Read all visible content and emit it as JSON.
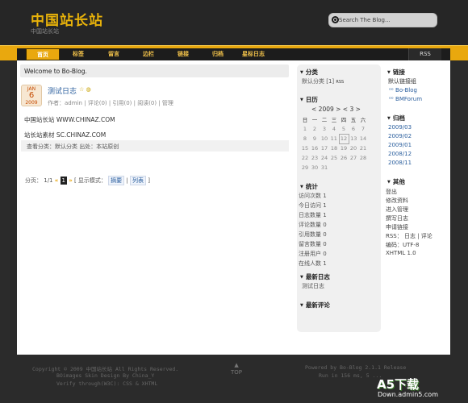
{
  "header": {
    "site_title": "中国站长站",
    "site_subtitle": "中国站长站",
    "search_placeholder": "Search The Blog..."
  },
  "nav": {
    "items": [
      "首页",
      "标签",
      "留言",
      "边栏",
      "链接",
      "归档",
      "星标日志"
    ],
    "rss_label": "RSS"
  },
  "welcome_text": "Welcome to Bo-Blog.",
  "post": {
    "date_month": "JAN",
    "date_day": "6",
    "date_year": "2009",
    "title": "测试日志",
    "icons": "☆ ◍",
    "meta": "作者：admin | 评论(0) | 引用(0) | 阅读(0) | 管理",
    "body_line1": "中国站长站 WWW.CHINAZ.COM",
    "body_line2": "站长站素材 SC.CHINAZ.COM",
    "footer": "查看分类：默认分类 出处：本站原创"
  },
  "pager": {
    "label": "分页：",
    "position": "1/1",
    "prev": "«",
    "current": "1",
    "next": "»",
    "mode_label": "[ 显示模式：",
    "mode_summary": "摘要",
    "separator": "|",
    "mode_list": "列表",
    "close": "]"
  },
  "sidebar1": {
    "category_title": "分类",
    "category_item": "默认分类 [1]",
    "category_rss": "RSS",
    "calendar_title": "日历",
    "calendar_header": "< 2009 >   < 3 >",
    "weekdays": [
      "日",
      "一",
      "二",
      "三",
      "四",
      "五",
      "六"
    ],
    "weeks": [
      [
        "1",
        "2",
        "3",
        "4",
        "5",
        "6",
        "7"
      ],
      [
        "8",
        "9",
        "10",
        "11",
        "12",
        "13",
        "14"
      ],
      [
        "15",
        "16",
        "17",
        "18",
        "19",
        "20",
        "21"
      ],
      [
        "22",
        "23",
        "24",
        "25",
        "26",
        "27",
        "28"
      ],
      [
        "29",
        "30",
        "31",
        "",
        "",
        "",
        ""
      ]
    ],
    "stats_title": "统计",
    "stats": [
      {
        "label": "访问次数",
        "value": "1"
      },
      {
        "label": "今日访问",
        "value": "1"
      },
      {
        "label": "日志数量",
        "value": "1"
      },
      {
        "label": "评论数量",
        "value": "0"
      },
      {
        "label": "引用数量",
        "value": "0"
      },
      {
        "label": "留言数量",
        "value": "0"
      },
      {
        "label": "注册用户",
        "value": "0"
      },
      {
        "label": "在线人数",
        "value": "1"
      }
    ],
    "latest_posts_title": "最新日志",
    "latest_post": "测试日志",
    "latest_comments_title": "最新评论"
  },
  "sidebar2": {
    "links_title": "链接",
    "links_sub": "默认链接组",
    "links": [
      "Bo-Blog",
      "BMForum"
    ],
    "archive_title": "归档",
    "archives": [
      "2009/03",
      "2009/02",
      "2009/01",
      "2008/12",
      "2008/11"
    ],
    "other_title": "其他",
    "other_items": [
      "登出",
      "修改资料",
      "进入管理",
      "撰写日志",
      "申请链接"
    ],
    "rss_line": "RSS： 日志 | 评论",
    "encoding": "编码：UTF-8",
    "xhtml": "XHTML 1.0"
  },
  "footer": {
    "copyright": "Copyright © 2009 中国站长站 All Rights Reserved.",
    "skin": "BOimages Skin Design By China_Y",
    "verify": "Verify through(W3C): CSS & XHTML",
    "top_arrow": "▲",
    "top_label": "TOP",
    "powered": "Powered by Bo-Blog 2.1.1 Release",
    "run": "Run in 156 ms, 5 ...",
    "watermark_brand": "A5下载",
    "watermark_url": "Down.admin5.com"
  }
}
